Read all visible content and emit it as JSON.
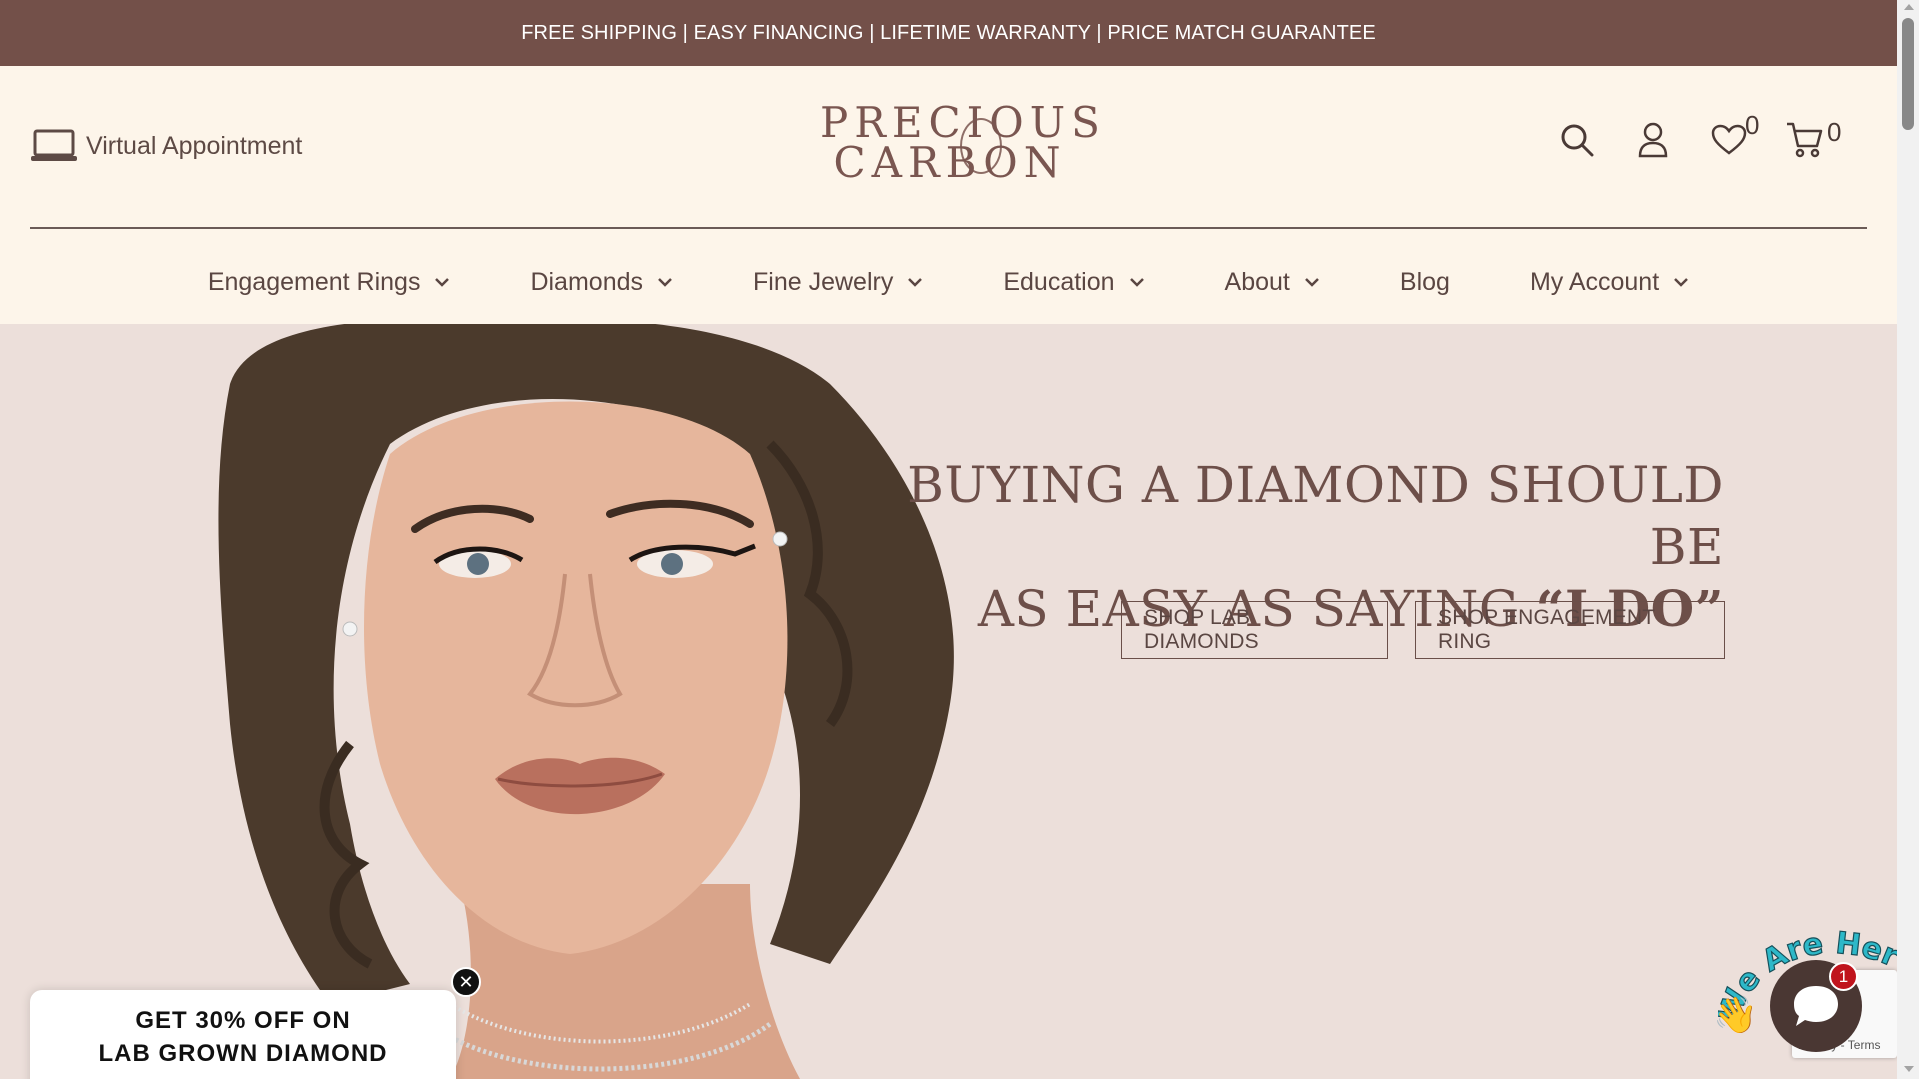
{
  "announcement": "FREE SHIPPING | EASY FINANCING | LIFETIME WARRANTY | PRICE MATCH GUARANTEE",
  "header": {
    "virtual_appointment": "Virtual Appointment",
    "logo_line1": "PRECIOUS",
    "logo_line2": "CARBON",
    "wishlist_count": "0",
    "cart_count": "0"
  },
  "nav": {
    "items": [
      {
        "label": "Engagement Rings"
      },
      {
        "label": "Diamonds"
      },
      {
        "label": "Fine Jewelry"
      },
      {
        "label": "Education"
      },
      {
        "label": "About"
      },
      {
        "label": "Blog"
      },
      {
        "label": "My Account"
      }
    ]
  },
  "hero": {
    "title_line1": "BUYING A DIAMOND SHOULD BE",
    "title_line2_plain": "AS EASY AS SAYING ",
    "title_line2_emph": "“I DO”",
    "button_lab": "SHOP LAB DIAMONDS",
    "button_ring": "SHOP ENGAGEMENT RING"
  },
  "promo": {
    "line1": "GET 30% OFF ON",
    "line2": "LAB GROWN DIAMOND"
  },
  "chat": {
    "bubble_text": "We Are Here!",
    "badge": "1",
    "recaptcha_text": "Privacy - Terms"
  },
  "colors": {
    "accent": "#735049",
    "header_bg": "#fdf5ea",
    "hero_bg": "#ecdfda"
  }
}
